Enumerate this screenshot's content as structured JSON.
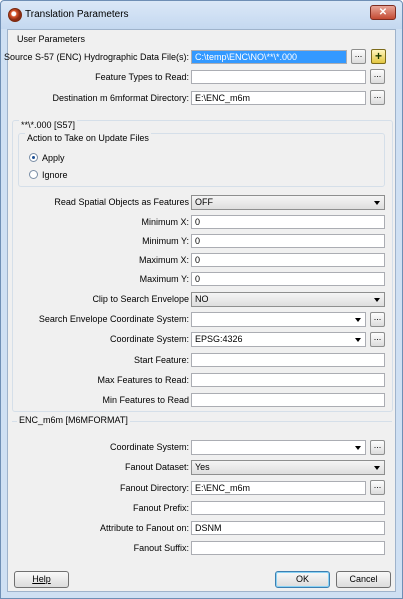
{
  "window": {
    "title": "Translation Parameters",
    "close_glyph": "✕",
    "icon": "fme-app-icon"
  },
  "user_parameters": {
    "label": "User Parameters",
    "source_label": "Source S-57 (ENC) Hydrographic Data File(s):",
    "source_value": "C:\\temp\\ENC\\NO\\**\\*.000",
    "feature_types_label": "Feature Types to Read:",
    "feature_types_value": "",
    "destination_label": "Destination m 6mformat Directory:",
    "destination_value": "E:\\ENC_m6m"
  },
  "s57": {
    "label": "**\\*.000 [S57]",
    "action_group_label": "Action to Take on Update Files",
    "apply_label": "Apply",
    "ignore_label": "Ignore",
    "selected_action": "Apply",
    "read_spatial_label": "Read Spatial Objects as Features",
    "read_spatial_value": "OFF",
    "min_x_label": "Minimum X:",
    "min_x_value": "0",
    "min_y_label": "Minimum Y:",
    "min_y_value": "0",
    "max_x_label": "Maximum X:",
    "max_x_value": "0",
    "max_y_label": "Maximum Y:",
    "max_y_value": "0",
    "clip_label": "Clip to Search Envelope",
    "clip_value": "NO",
    "envelope_cs_label": "Search Envelope Coordinate System:",
    "envelope_cs_value": "",
    "cs_label": "Coordinate System:",
    "cs_value": "EPSG:4326",
    "start_feature_label": "Start Feature:",
    "start_feature_value": "",
    "max_features_label": "Max Features to Read:",
    "max_features_value": "",
    "min_features_label": "Min Features to Read",
    "min_features_value": ""
  },
  "m6m": {
    "label": "ENC_m6m [M6MFORMAT]",
    "cs_label": "Coordinate System:",
    "cs_value": "",
    "fanout_dataset_label": "Fanout Dataset:",
    "fanout_dataset_value": "Yes",
    "fanout_dir_label": "Fanout Directory:",
    "fanout_dir_value": "E:\\ENC_m6m",
    "fanout_prefix_label": "Fanout Prefix:",
    "fanout_prefix_value": "",
    "attr_fanout_label": "Attribute to Fanout on:",
    "attr_fanout_value": "DSNM",
    "fanout_suffix_label": "Fanout Suffix:",
    "fanout_suffix_value": ""
  },
  "buttons": {
    "help": "Help",
    "ok": "OK",
    "cancel": "Cancel",
    "browse": "...",
    "add": "+"
  }
}
